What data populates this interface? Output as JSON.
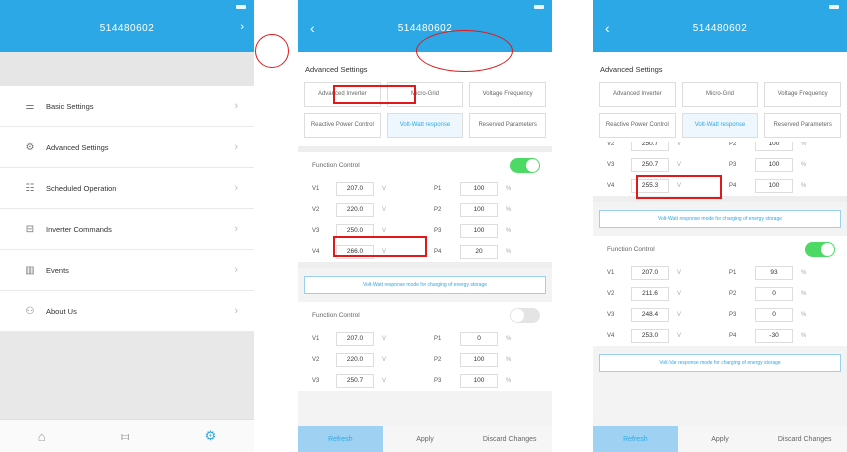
{
  "device_id": "514480602",
  "screen1": {
    "menu": [
      {
        "icon": "sliders-icon",
        "glyph": "⚌",
        "label": "Basic Settings"
      },
      {
        "icon": "gear-icon",
        "glyph": "⚙",
        "label": "Advanced Settings"
      },
      {
        "icon": "schedule-icon",
        "glyph": "☷",
        "label": "Scheduled Operation"
      },
      {
        "icon": "inverter-icon",
        "glyph": "⊟",
        "label": "Inverter Commands"
      },
      {
        "icon": "events-icon",
        "glyph": "▥",
        "label": "Events"
      },
      {
        "icon": "user-icon",
        "glyph": "⚇",
        "label": "About Us"
      }
    ],
    "tabs": [
      {
        "icon": "home-tab-icon",
        "glyph": "⌂"
      },
      {
        "icon": "adjust-tab-icon",
        "glyph": "⧦"
      },
      {
        "icon": "settings-tab-icon",
        "glyph": "⚙"
      }
    ]
  },
  "advanced": {
    "title": "Advanced Settings",
    "grid": [
      "Advanced Inverter",
      "Micro-Grid",
      "Voltage Frequency",
      "Reactive Power Control",
      "Volt-Watt response",
      "Reserved Parameters"
    ],
    "function_control": "Function Control",
    "unit_v": "V",
    "unit_p": "%",
    "refresh": "Refresh",
    "apply": "Apply",
    "discard": "Discard Changes"
  },
  "screen2": {
    "block1": {
      "rows": [
        {
          "vk": "V1",
          "v": "207.0",
          "pk": "P1",
          "p": "100"
        },
        {
          "vk": "V2",
          "v": "220.0",
          "pk": "P2",
          "p": "100"
        },
        {
          "vk": "V3",
          "v": "250.0",
          "pk": "P3",
          "p": "100"
        },
        {
          "vk": "V4",
          "v": "266.0",
          "pk": "P4",
          "p": "20"
        }
      ],
      "toggle_on": true
    },
    "note": "Volt-Watt response mode for charging of energy storage",
    "block2": {
      "rows": [
        {
          "vk": "V1",
          "v": "207.0",
          "pk": "P1",
          "p": "0"
        },
        {
          "vk": "V2",
          "v": "220.0",
          "pk": "P2",
          "p": "100"
        },
        {
          "vk": "V3",
          "v": "250.7",
          "pk": "P3",
          "p": "100"
        }
      ],
      "toggle_on": false
    }
  },
  "screen3": {
    "partial": {
      "vk": "V2",
      "v": "250.7",
      "pk": "P2",
      "p": "100"
    },
    "top_rows": [
      {
        "vk": "V3",
        "v": "250.7",
        "pk": "P3",
        "p": "100"
      },
      {
        "vk": "V4",
        "v": "255.3",
        "pk": "P4",
        "p": "100"
      }
    ],
    "note1": "Volt-Watt response mode for charging of energy storage",
    "block": {
      "rows": [
        {
          "vk": "V1",
          "v": "207.0",
          "pk": "P1",
          "p": "93"
        },
        {
          "vk": "V2",
          "v": "211.6",
          "pk": "P2",
          "p": "0"
        },
        {
          "vk": "V3",
          "v": "248.4",
          "pk": "P3",
          "p": "0"
        },
        {
          "vk": "V4",
          "v": "253.0",
          "pk": "P4",
          "p": "-30"
        }
      ],
      "toggle_on": true
    },
    "note2": "Volt-Var response mode for charging of energy storage"
  }
}
